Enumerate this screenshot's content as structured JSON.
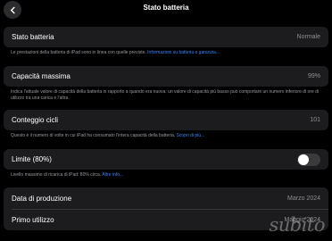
{
  "header": {
    "title": "Stato batteria"
  },
  "sections": [
    {
      "label": "Stato batteria",
      "value": "Normale",
      "desc": "Le prestazioni della batteria di iPad sono in linea con quelle previste.",
      "link": "Informazioni su batteria e garanzia..."
    },
    {
      "label": "Capacità massima",
      "value": "99%",
      "desc": "Indica l'attuale valore di capacità della batteria in rapporto a quando era nuova: un valore di capacità più basso può comportare un numero inferiore di ore di utilizzo tra una carica e l'altra.",
      "link": ""
    },
    {
      "label": "Conteggio cicli",
      "value": "101",
      "desc": "Questo è il numero di volte in cui iPad ha consumato l'intera capacità della batteria.",
      "link": "Scopri di più..."
    },
    {
      "label": "Limite (80%)",
      "toggle_on": false,
      "desc": "Livello massimo di ricarica di iPad: 80% circa.",
      "link": "Altre info..."
    }
  ],
  "dates": [
    {
      "label": "Data di produzione",
      "value": "Marzo 2024"
    },
    {
      "label": "Primo utilizzo",
      "value": "Maggio 2024"
    }
  ],
  "watermark": "subito",
  "colors": {
    "background": "#000000",
    "card": "#1c1c1e",
    "link": "#3a82f7",
    "toggle_off": "#3a3a3c"
  },
  "icons": {
    "back": "chevron-left-icon"
  }
}
